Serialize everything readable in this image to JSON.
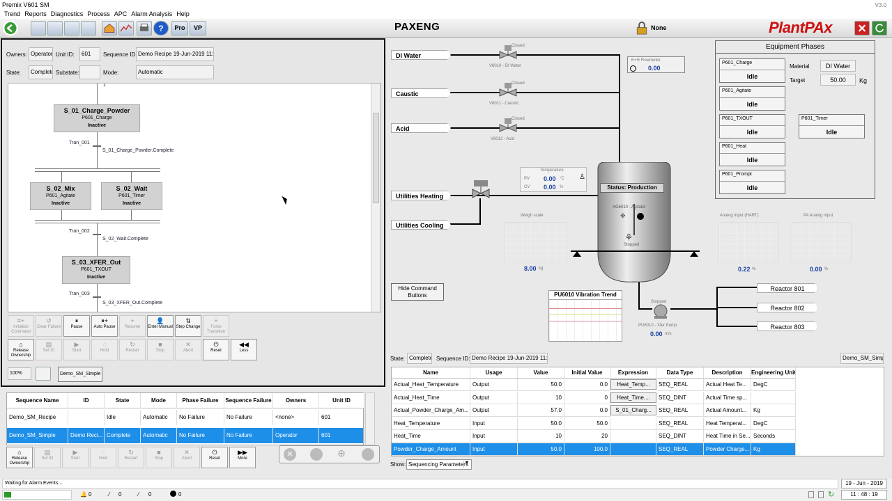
{
  "window": {
    "title": "Premix V601 SM",
    "version": "V3.0"
  },
  "menu": [
    "Trend",
    "Reports",
    "Diagnostics",
    "Process",
    "APC",
    "Alarm Analysis",
    "Help"
  ],
  "toolbar": {
    "title": "PAXENG",
    "security_user": "None",
    "logo": "PlantPAx",
    "pro_label": "Pro",
    "vp_label": "VP"
  },
  "sequence": {
    "owners_label": "Owners:",
    "owners": "Operator",
    "unit_label": "Unit ID:",
    "unit": "601",
    "seqid_label": "Sequence ID:",
    "seqid": "Demo Recipe 19-Jun-2019 11:30",
    "state_label": "State:",
    "state": "Complete",
    "substate_label": "Substate:",
    "substate": "",
    "mode_label": "Mode:",
    "mode": "Automatic"
  },
  "sfc": {
    "top_marker": "1",
    "s01": {
      "title": "S_01_Charge_Powder",
      "phase": "P601_Charge",
      "status": "Inactive"
    },
    "t001": {
      "name": "Tran_001",
      "cond": "S_01_Charge_Powder.Complete"
    },
    "s02mix": {
      "title": "S_02_Mix",
      "phase": "P601_Agitate",
      "status": "Inactive"
    },
    "s02wait": {
      "title": "S_02_Wait",
      "phase": "P601_Timer",
      "status": "Inactive"
    },
    "t002": {
      "name": "Tran_002",
      "cond": "S_02_Wait.Complete"
    },
    "s03": {
      "title": "S_03_XFER_Out",
      "phase": "P601_TXOUT",
      "status": "Inactive"
    },
    "t003": {
      "name": "Tran_003",
      "cond": "S_03_XFER_Out.Complete"
    }
  },
  "cmd_row1": [
    {
      "label": "Initialize Command",
      "icon": "≡+",
      "on": false
    },
    {
      "label": "Clear Failure",
      "icon": "↺",
      "on": false
    },
    {
      "label": "Pause",
      "icon": "⏸",
      "on": true
    },
    {
      "label": "Auto Pause",
      "icon": "⏸+",
      "on": true
    },
    {
      "label": "Resume",
      "icon": "+",
      "on": false
    },
    {
      "label": "Enter Manual",
      "icon": "👤",
      "on": true
    },
    {
      "label": "Step Change",
      "icon": "⇅",
      "on": true
    },
    {
      "label": "Force Transition",
      "icon": "+",
      "on": false
    }
  ],
  "cmd_row2": [
    {
      "label": "Release Ownership",
      "icon": "⌂",
      "on": true
    },
    {
      "label": "Set ID",
      "icon": "▤",
      "on": false
    },
    {
      "label": "Start",
      "icon": "▶",
      "on": false
    },
    {
      "label": "Hold",
      "icon": "◌",
      "on": false
    },
    {
      "label": "Restart",
      "icon": "↻",
      "on": false
    },
    {
      "label": "Stop",
      "icon": "■",
      "on": false
    },
    {
      "label": "Abort",
      "icon": "✕",
      "on": false
    },
    {
      "label": "Reset",
      "icon": "⏻",
      "on": true
    },
    {
      "label": "Less",
      "icon": "◀◀",
      "on": true
    }
  ],
  "zoom": "100%",
  "sm_name": "Demo_SM_Simple",
  "seq_table": {
    "headers": [
      "Sequence Name",
      "ID",
      "State",
      "Mode",
      "Phase Failure",
      "Sequence Failure",
      "Owners",
      "Unit ID"
    ],
    "rows": [
      [
        "Demo_SM_Recipe",
        "",
        "Idle",
        "Automatic",
        "No Failure",
        "No Failure",
        "<none>",
        "601"
      ],
      [
        "Demo_SM_Simple",
        "Demo Reci...",
        "Complete",
        "Automatic",
        "No Failure",
        "No Failure",
        "Operator",
        "601"
      ]
    ]
  },
  "cmd_row3": [
    {
      "label": "Release Ownership",
      "icon": "⌂",
      "on": true
    },
    {
      "label": "Set ID",
      "icon": "▤",
      "on": false
    },
    {
      "label": "Start",
      "icon": "▶",
      "on": false
    },
    {
      "label": "Hold",
      "icon": "◌",
      "on": false
    },
    {
      "label": "Restart",
      "icon": "↻",
      "on": false
    },
    {
      "label": "Stop",
      "icon": "■",
      "on": false
    },
    {
      "label": "Abort",
      "icon": "✕",
      "on": false
    },
    {
      "label": "Reset",
      "icon": "⏻",
      "on": true
    },
    {
      "label": "More",
      "icon": "▶▶",
      "on": true
    }
  ],
  "process": {
    "di_water": "DI Water",
    "caustic": "Caustic",
    "acid": "Acid",
    "util_heat": "Utilities Heating",
    "util_cool": "Utilities Cooling",
    "v6010": "V6010 - DI Water",
    "v6011": "V6011 - Caustic",
    "v6012": "V6012 - Acid",
    "closed": "Closed",
    "flowmeter": "E+H Flowmeter",
    "flow_val": "0.00",
    "temp_title": "Temperature",
    "pv_label": "PV",
    "pv": "0.00",
    "cv_label": "CV",
    "cv": "0.00",
    "degc": "°C",
    "pct": "%",
    "status": "Status: Production",
    "agitator": "AG6010 - Agitator",
    "ag_state": "Stopped",
    "weigh_title": "Weigh scale",
    "weigh_val": "8.00",
    "weigh_unit": "kg",
    "hide_btn": "Hide Command Buttons",
    "vib_title": "PU6010 Vibration Trend",
    "pump_state": "Stopped",
    "pump": "PU6010 - Xfer Pump",
    "pump_val": "0.00",
    "pump_unit": "m/s",
    "hart_title": "Analog Input (HART)",
    "hart_val": "0.22",
    "pa_title": "PA Analog Input",
    "pa_val": "0.00",
    "r801": "Reactor 801",
    "r802": "Reactor 802",
    "r803": "Reactor 803"
  },
  "phases": {
    "title": "Equipment Phases",
    "charge": {
      "name": "P601_Charge",
      "state": "Idle"
    },
    "agitate": {
      "name": "P601_Agitate",
      "state": "Idle"
    },
    "txout": {
      "name": "P601_TXOUT",
      "state": "Idle"
    },
    "timer": {
      "name": "P601_Timer",
      "state": "Idle"
    },
    "heat": {
      "name": "P601_Heat",
      "state": "Idle"
    },
    "prompt": {
      "name": "P601_Prompt",
      "state": "Idle"
    },
    "material_label": "Material",
    "material": "DI Water",
    "target_label": "Target",
    "target": "50.00",
    "target_unit": "Kg"
  },
  "params": {
    "state_label": "State:",
    "state": "Complete",
    "seqid_label": "Sequence ID:",
    "seqid": "Demo Recipe 19-Jun-2019 11:30",
    "sm": "Demo_SM_Simple",
    "headers": [
      "Name",
      "Usage",
      "Value",
      "Initial Value",
      "Expression",
      "Data Type",
      "Description",
      "Engineering Unit"
    ],
    "rows": [
      [
        "Actual_Heat_Temperature",
        "Output",
        "50.0",
        "0.0",
        "Heat_Temp...",
        "SEQ_REAL",
        "Actual Heat Te...",
        "DegC"
      ],
      [
        "Actual_Heat_Time",
        "Output",
        "10",
        "0",
        "Heat_Time....",
        "SEQ_DINT",
        "Actual Time sp...",
        ""
      ],
      [
        "Actual_Powder_Charge_Am...",
        "Output",
        "57.0",
        "0.0",
        "S_01_Charg...",
        "SEQ_REAL",
        "Actual Amount...",
        "Kg"
      ],
      [
        "Heat_Temperature",
        "Input",
        "50.0",
        "50.0",
        "",
        "SEQ_REAL",
        "Heat Temperat...",
        "DegC"
      ],
      [
        "Heat_Time",
        "Input",
        "10",
        "20",
        "",
        "SEQ_DINT",
        "Heat Time in Se...",
        "Seconds"
      ],
      [
        "Powder_Charge_Amount",
        "Input",
        "50.0",
        "100.0",
        "",
        "SEQ_REAL",
        "Powder Charge...",
        "Kg"
      ]
    ],
    "show_label": "Show:",
    "show": "Sequencing Parameters"
  },
  "status": {
    "message": "Waiting for Alarm Events...",
    "c1": "0",
    "c2": "0",
    "c3": "0",
    "c4": "0",
    "date": "19 - Jun - 2019",
    "time": "11 : 48 : 19"
  }
}
